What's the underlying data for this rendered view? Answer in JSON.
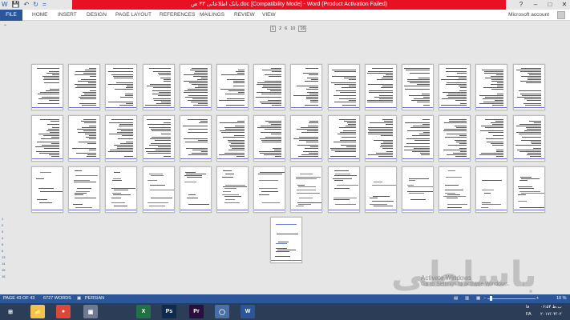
{
  "window": {
    "title": "بانک اطلاعاتی ۴۳ ص.doc [Compatibility Mode] - Word (Product Activation Failed)",
    "account": "Microsoft account",
    "help": "?",
    "min": "–",
    "max": "□",
    "close": "✕"
  },
  "qat": {
    "word": "W",
    "save": "💾",
    "undo": "↶",
    "redo": "↻",
    "custom": "="
  },
  "ribbon": {
    "file": "FILE",
    "tabs": [
      "HOME",
      "INSERT",
      "DESIGN",
      "PAGE LAYOUT",
      "REFERENCES",
      "MAILINGS",
      "REVIEW",
      "VIEW"
    ]
  },
  "page_selector": [
    "1",
    "2",
    "6",
    "10",
    "16"
  ],
  "collapse_label": "⌃",
  "left_nav": [
    "1",
    "2",
    "3",
    "4",
    "5",
    "6",
    "13",
    "14",
    "15",
    "16"
  ],
  "watermark": {
    "logo": "باسلطی",
    "activate_title": "Activate Windows",
    "activate_sub": "Go to Settings to activate Windows."
  },
  "status": {
    "page": "PAGE 43 OF 43",
    "words": "6727 WORDS",
    "language": "PERSIAN",
    "zoom": "10 %",
    "zoom_level_percent": 10,
    "minus": "−",
    "plus": "+"
  },
  "taskbar": {
    "apps": [
      {
        "name": "windows",
        "glyph": "⊞",
        "color": "#2c3e57"
      },
      {
        "name": "explorer",
        "glyph": "📁",
        "color": "#f2c14e"
      },
      {
        "name": "chrome",
        "glyph": "●",
        "color": "#d94838"
      },
      {
        "name": "remote",
        "glyph": "▣",
        "color": "#6d7a91"
      },
      {
        "name": "excel",
        "glyph": "X",
        "color": "#207245"
      },
      {
        "name": "photoshop",
        "glyph": "Ps",
        "color": "#0f2a4a"
      },
      {
        "name": "premiere",
        "glyph": "Pr",
        "color": "#2a0e3d"
      },
      {
        "name": "chat",
        "glyph": "◯",
        "color": "#4a6fa5"
      },
      {
        "name": "word",
        "glyph": "W",
        "color": "#2b579a"
      }
    ],
    "tray_lang": "FA",
    "tray_mode": "فا",
    "tray_time": "۰۶:۵۴ ب.ظ",
    "tray_date": "۲۰۱۷/۰۳/۰۲"
  },
  "colors": {
    "word_blue": "#2b579a",
    "title_red": "#e81123",
    "page_underline": "#6a6ad0"
  }
}
